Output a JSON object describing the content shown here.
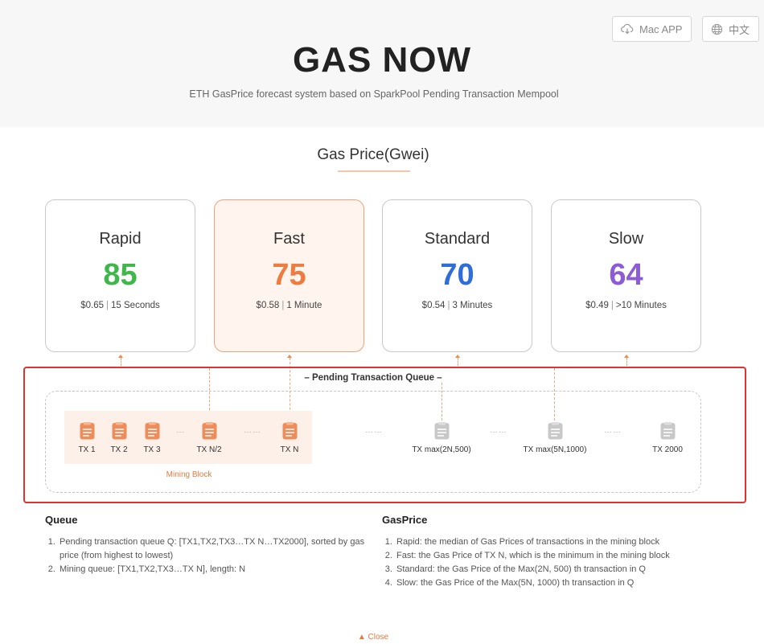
{
  "header": {
    "mac_app_label": "Mac APP",
    "lang_label": "中文",
    "title": "GAS NOW",
    "subtitle": "ETH GasPrice forecast system based on SparkPool Pending Transaction Mempool"
  },
  "gas_price": {
    "section_title": "Gas Price(Gwei)",
    "cards": [
      {
        "name": "Rapid",
        "price": "85",
        "usd": "$0.65",
        "time": "15 Seconds",
        "color": "#3fb74a"
      },
      {
        "name": "Fast",
        "price": "75",
        "usd": "$0.58",
        "time": "1 Minute",
        "color": "#ec7c3f"
      },
      {
        "name": "Standard",
        "price": "70",
        "usd": "$0.54",
        "time": "3 Minutes",
        "color": "#2f6ddb"
      },
      {
        "name": "Slow",
        "price": "64",
        "usd": "$0.49",
        "time": ">10 Minutes",
        "color": "#8b5cd6"
      }
    ],
    "separator": "|"
  },
  "queue": {
    "title": "– Pending Transaction Queue –",
    "mining_label": "Mining Block",
    "dots_short": "…",
    "dots_long": "……",
    "tx": [
      "TX 1",
      "TX 2",
      "TX 3",
      "TX N/2",
      "TX N",
      "TX max(2N,500)",
      "TX max(5N,1000)",
      "TX 2000"
    ]
  },
  "info": {
    "queue_heading": "Queue",
    "queue_items": [
      "Pending transaction queue Q: [TX1,TX2,TX3…TX N…TX2000], sorted by gas price (from highest to lowest)",
      "Mining queue: [TX1,TX2,TX3…TX N], length: N"
    ],
    "gas_heading": "GasPrice",
    "gas_items": [
      "Rapid: the median of Gas Prices of transactions in the mining block",
      "Fast: the Gas Price of TX N, which is the minimum in the mining block",
      "Standard: the Gas Price of the Max(2N, 500) th transaction in Q",
      "Slow: the Gas Price of the Max(5N, 1000) th transaction in Q"
    ]
  },
  "close_label": "▲ Close",
  "colors": {
    "accent": "#e37b3f",
    "highlight": "#e1322d",
    "tx_active": "#ef8d5a",
    "tx_inactive": "#c8c8c8"
  }
}
